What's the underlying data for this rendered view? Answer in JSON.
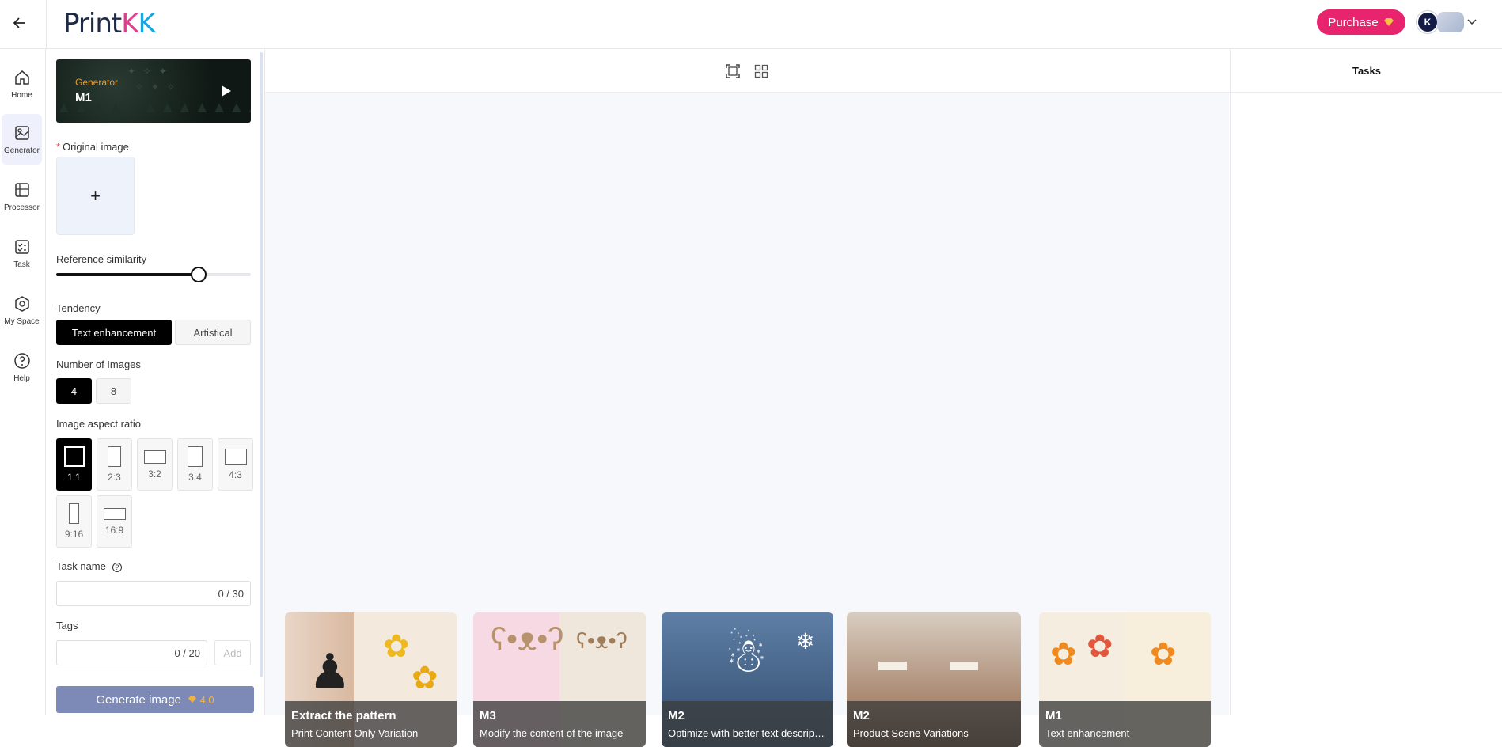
{
  "header": {
    "logo_prefix": "Print",
    "logo_k1": "K",
    "logo_k2": "K",
    "purchase_label": "Purchase",
    "avatar_initials": "K"
  },
  "nav": {
    "items": [
      {
        "label": "Home",
        "icon": "home-icon"
      },
      {
        "label": "Generator",
        "icon": "generator-icon"
      },
      {
        "label": "Processor",
        "icon": "processor-icon"
      },
      {
        "label": "Task",
        "icon": "task-icon"
      },
      {
        "label": "My Space",
        "icon": "my-space-icon"
      },
      {
        "label": "Help",
        "icon": "help-icon"
      }
    ],
    "active": "Generator"
  },
  "panel": {
    "banner": {
      "category": "Generator",
      "model": "M1"
    },
    "original_image_label": "Original image",
    "reference_similarity_label": "Reference similarity",
    "reference_similarity_value": 0.75,
    "tendency_label": "Tendency",
    "tendency_options": [
      "Text enhancement",
      "Artistical"
    ],
    "tendency_selected": "Text enhancement",
    "num_images_label": "Number of Images",
    "num_images_options": [
      "4",
      "8"
    ],
    "num_images_selected": "4",
    "aspect_label": "Image aspect ratio",
    "aspect_options": [
      "1:1",
      "2:3",
      "3:2",
      "3:4",
      "4:3",
      "9:16",
      "16:9"
    ],
    "aspect_selected": "1:1",
    "task_name_label": "Task name",
    "task_name_counter": "0 / 30",
    "tags_label": "Tags",
    "tags_counter": "0 / 20",
    "add_label": "Add",
    "generate_label": "Generate image",
    "generate_cost": "4.0"
  },
  "tasks": {
    "title": "Tasks"
  },
  "cards": [
    {
      "title": "Extract the pattern",
      "subtitle": "Print Content Only Variation"
    },
    {
      "title": "M3",
      "subtitle": "Modify the content of the image"
    },
    {
      "title": "M2",
      "subtitle": "Optimize with better text description"
    },
    {
      "title": "M2",
      "subtitle": "Product Scene Variations"
    },
    {
      "title": "M1",
      "subtitle": "Text enhancement"
    }
  ],
  "colors": {
    "accent": "#e9246f",
    "generate_button": "#7d89b7",
    "selected": "#000000"
  }
}
